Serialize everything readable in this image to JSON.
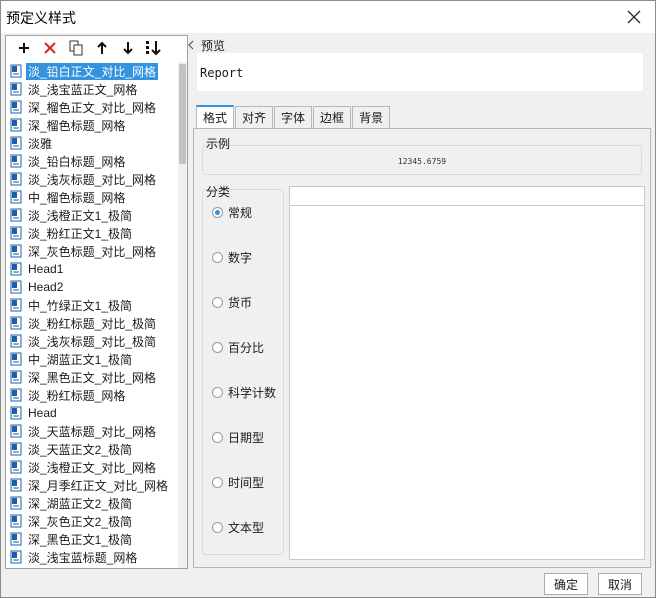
{
  "window": {
    "title": "预定义样式"
  },
  "toolbar": {
    "buttons": [
      {
        "name": "add",
        "icon": "plus-icon"
      },
      {
        "name": "delete",
        "icon": "red-x-icon"
      },
      {
        "name": "copy",
        "icon": "copy-icon"
      },
      {
        "name": "move-up",
        "icon": "arrow-up-icon"
      },
      {
        "name": "move-down",
        "icon": "arrow-down-icon"
      },
      {
        "name": "sort",
        "icon": "sort-icon"
      }
    ]
  },
  "style_list": {
    "selected_index": 0,
    "items": [
      "淡_铅白正文_对比_网格",
      "淡_浅宝蓝正文_网格",
      "深_榴色正文_对比_网格",
      "深_榴色标题_网格",
      "淡雅",
      "淡_铅白标题_网格",
      "淡_浅灰标题_对比_网格",
      "中_榴色标题_网格",
      "淡_浅橙正文1_极简",
      "淡_粉红正文1_极简",
      "深_灰色标题_对比_网格",
      "Head1",
      "Head2",
      "中_竹绿正文1_极简",
      "淡_粉红标题_对比_极简",
      "淡_浅灰标题_对比_极简",
      "中_湖蓝正文1_极简",
      "深_黑色正文_对比_网格",
      "淡_粉红标题_网格",
      "Head",
      "淡_天蓝标题_对比_网格",
      "淡_天蓝正文2_极简",
      "淡_浅橙正文_对比_网格",
      "深_月季红正文_对比_网格",
      "深_湖蓝正文2_极简",
      "深_灰色正文2_极简",
      "深_黑色正文1_极简",
      "淡_浅宝蓝标题_网格"
    ]
  },
  "preview": {
    "label": "预览",
    "text": "Report"
  },
  "tabs": [
    "格式",
    "对齐",
    "字体",
    "边框",
    "背景"
  ],
  "format_tab": {
    "example_label": "示例",
    "example_value": "12345.6759",
    "category_label": "分类",
    "categories": [
      "常规",
      "数字",
      "货币",
      "百分比",
      "科学计数",
      "日期型",
      "时间型",
      "文本型"
    ],
    "selected_category": "常规",
    "format_input_value": ""
  },
  "footer": {
    "ok_label": "确定",
    "cancel_label": "取消"
  },
  "colors": {
    "accent": "#3393df",
    "delete": "#e02020"
  }
}
